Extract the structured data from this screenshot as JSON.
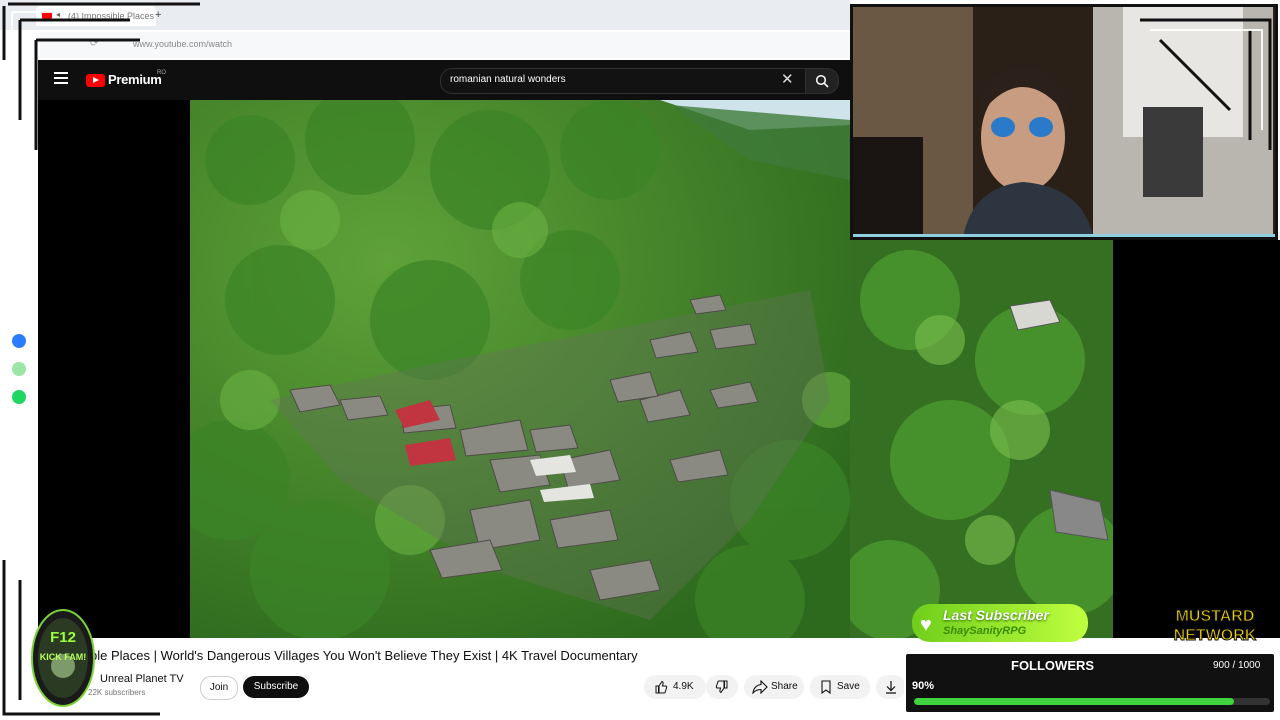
{
  "browser": {
    "tab_title": "(4) Impossible Places",
    "new_tab_symbol": "+",
    "url": "www.youtube.com/watch"
  },
  "youtube": {
    "logo_text": "Premium",
    "logo_region": "RO",
    "search_value": "romanian natural wonders",
    "clear_symbol": "✕"
  },
  "video": {
    "title_prefix": "ble Places",
    "title": "| World's Dangerous Villages You Won't Believe They Exist | 4K Travel Documentary",
    "channel_name": "Unreal Planet TV",
    "subscribers": "22K subscribers",
    "join_label": "Join",
    "subscribe_label": "Subscribe",
    "like_count": "4.9K",
    "share_label": "Share",
    "save_label": "Save"
  },
  "overlay": {
    "badge_line1": "F12",
    "badge_line2": "KICK FAM!",
    "last_subscriber_label": "Last Subscriber",
    "last_subscriber_name": "ShaySanityRPG",
    "network_line1": "MUSTARD",
    "network_line2": "NETWORK",
    "followers_label": "FOLLOWERS",
    "followers_count": "900 / 1000",
    "followers_percent_label": "90%",
    "followers_progress": 0.9
  },
  "colors": {
    "youtube_red": "#ff0000",
    "progress_green": "#3fd43f",
    "last_sub_green": "#8be02a"
  },
  "icons": [
    "menu-icon",
    "youtube-logo-icon",
    "close-icon",
    "search-icon",
    "like-icon",
    "dislike-icon",
    "share-icon",
    "save-icon",
    "download-icon",
    "messenger-icon",
    "whatsapp-icon",
    "spotify-icon",
    "heart-icon"
  ]
}
